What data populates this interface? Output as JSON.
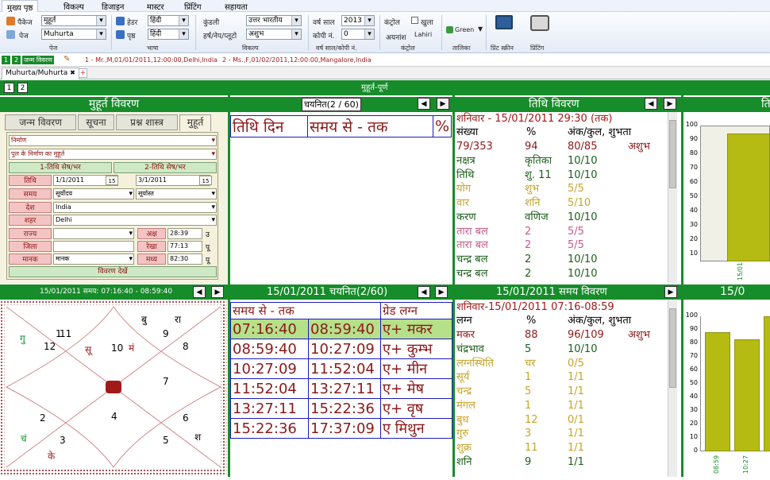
{
  "menu": [
    "मुख्य पृष्ठ",
    "विकल्प",
    "डिजाइन",
    "मास्टर",
    "प्रिंटिंग",
    "सहायता"
  ],
  "ribbon": {
    "package_label": "पैकेज",
    "package_value": "मुहूर्त",
    "page_label": "पेज",
    "page_value": "Muhurta",
    "group_page": "पेज",
    "header_label": "हेडर",
    "header_value": "हिंदी",
    "body_label": "पृष्ठ",
    "body_value": "हिंदी",
    "group_language": "भाषा",
    "kundali_label": "कुंडली",
    "kundali_value": "उत्तर भारतीय",
    "harsh_label": "हर्ष/नेप/प्लूटो",
    "harsh_value": "अशुभ",
    "group_option": "विकल्प",
    "year_label": "वर्ष साल",
    "year_value": "2013",
    "copy_label": "कोपी नं.",
    "copy_value": "0",
    "group_year": "वर्ष साल/कोपी नं.",
    "control_label": "कंट्रोल",
    "open_label": "खुला",
    "ayanamsha_label": "अयनांश",
    "ayanamsha_value": "Lahiri",
    "group_control": "कंट्रोल",
    "theme_value": "Green",
    "group_table": "तालिका",
    "print_screen": "प्रिंट स्क्रीन",
    "printing": "प्रिंटिंग"
  },
  "strip": {
    "n1": "1",
    "n2": "2",
    "janma": "जन्म विवरण",
    "rec1": "1 - Mr.,M,01/01/2011,12:00:00,Delhi,India",
    "rec2": "2 - Ms.,F,01/02/2011,12:00:00,Mangalore,India"
  },
  "doc_tab": {
    "label": "Muhurta/Muhurta",
    "close": "✖",
    "add": "+"
  },
  "top_bar": {
    "n1": "1",
    "n2": "2",
    "title": "मुहूर्त-पूर्ण"
  },
  "details": {
    "title": "मुहूर्त विवरण",
    "tabs": [
      "जन्म विवरण",
      "सूचना",
      "प्रश्न शास्त्र",
      "मुहूर्त"
    ],
    "sel1": "निर्माण",
    "sel2": "पुल के निर्माण का मुहूर्त",
    "tithi_btn1": "1-तिथि सेष/भर",
    "tithi_btn2": "2-तिथि सेष/भर",
    "tithi_label": "तिथि",
    "date1": "1/1/2011",
    "date2": "3/1/2011",
    "cal": "15",
    "samay_label": "समय",
    "samay1": "सूर्योदय",
    "samay2": "सूर्यास्त",
    "desh_label": "देश",
    "desh": "India",
    "shahar_label": "शहर",
    "shahar": "Delhi",
    "rajya_label": "राज्य",
    "aksh_label": "अक्ष",
    "aksh": "28:39",
    "aksh_dir": "उ",
    "jila_label": "जिला",
    "rekha_label": "रेखा",
    "rekha": "77:13",
    "rekha_dir": "पू",
    "manak_label": "मानक",
    "manak": "मानक",
    "madhya_label": "मध्य",
    "madhya": "82:30",
    "madhya_dir": "पू",
    "show_btn": "विवरण देखें"
  },
  "selected": {
    "title": "चयनित(2 / 60)",
    "h1": "तिथि दिन",
    "h2": "समय से - तक",
    "h3": "%"
  },
  "tithi": {
    "title": "तिथि विवरण",
    "line1": "शनिवार - 15/01/2011 29:30 (तक)",
    "header": [
      "संख्या",
      "%",
      "अंक/कुल, शुभता"
    ],
    "summary": [
      "79/353",
      "94",
      "80/85",
      "अशुभ"
    ],
    "rows": [
      [
        "नक्षत्र",
        "कृतिका",
        "10/10"
      ],
      [
        "तिथि",
        "शु. 11",
        "10/10"
      ],
      [
        "योग",
        "शुभ",
        "5/5"
      ],
      [
        "वार",
        "शनि",
        "5/10"
      ],
      [
        "करण",
        "वणिज",
        "10/10"
      ],
      [
        "तारा बल",
        "2",
        "5/5"
      ],
      [
        "तारा बल",
        "2",
        "5/5"
      ],
      [
        "चन्द्र बल",
        "2",
        "10/10"
      ],
      [
        "चन्द्र बल",
        "2",
        "10/10"
      ]
    ]
  },
  "chart_top": {
    "title": "ति",
    "ticks": [
      "100",
      "90",
      "80",
      "70",
      "60",
      "50",
      "40",
      "30",
      "20",
      "10"
    ],
    "xlabel": "15/01"
  },
  "lagna_bar": {
    "title": "15/01/2011 समय: 07:16:40 - 08:59:40"
  },
  "kundali": {
    "houses": [
      "1",
      "2",
      "3",
      "4",
      "5",
      "6",
      "7",
      "8",
      "9",
      "10",
      "11",
      "12"
    ],
    "planets": {
      "su": "सू",
      "ma": "मं",
      "bu": "बु",
      "ra": "रा",
      "gu": "गु",
      "ch": "चं",
      "ke": "के",
      "sh": "श"
    }
  },
  "lagna": {
    "title": "15/01/2011 चयनित(2/60)",
    "h1": "समय से - तक",
    "h2": "ग्रेड लग्न",
    "rows": [
      [
        "07:16:40",
        "08:59:40",
        "ए+ मकर"
      ],
      [
        "08:59:40",
        "10:27:09",
        "ए+ कुम्भ"
      ],
      [
        "10:27:09",
        "11:52:04",
        "ए+ मीन"
      ],
      [
        "11:52:04",
        "13:27:11",
        "ए+ मेष"
      ],
      [
        "13:27:11",
        "15:22:36",
        "ए+ वृष"
      ],
      [
        "15:22:36",
        "17:37:09",
        "ए  मिथुन"
      ]
    ]
  },
  "samay": {
    "title": "15/01/2011 समय विवरण",
    "line1": "शनिवार-15/01/2011 07:16-08:59",
    "header": [
      "लग्न",
      "%",
      "अंक/कुल, शुभता"
    ],
    "summary": [
      "मकर",
      "88",
      "96/109",
      "अशुभ"
    ],
    "rows": [
      [
        "चंद्रभाव",
        "5",
        "10/10"
      ],
      [
        "लग्नस्थिति",
        "चर",
        "0/5"
      ],
      [
        "सूर्य",
        "1",
        "1/1"
      ],
      [
        "चन्द्र",
        "5",
        "1/1"
      ],
      [
        "मंगल",
        "1",
        "1/1"
      ],
      [
        "बुध",
        "12",
        "0/1"
      ],
      [
        "गुरु",
        "3",
        "1/1"
      ],
      [
        "शुक्र",
        "11",
        "1/1"
      ],
      [
        "शनि",
        "9",
        "1/1"
      ]
    ]
  },
  "chart_bottom": {
    "title": "15/0",
    "ticks": [
      "100",
      "90",
      "80",
      "70",
      "60",
      "50",
      "40",
      "30",
      "20",
      "10",
      "0"
    ],
    "xlabels": [
      "08:59",
      "10:27",
      "11:"
    ]
  },
  "chart_data": [
    {
      "type": "bar",
      "categories": [
        "15/01"
      ],
      "values": [
        94
      ],
      "ylim": [
        0,
        100
      ]
    },
    {
      "type": "bar",
      "categories": [
        "08:59",
        "10:27",
        "11:"
      ],
      "values": [
        88,
        83,
        100
      ],
      "ylim": [
        0,
        100
      ]
    }
  ],
  "colors": {
    "green": "#178c2a",
    "olive": "#b5bb13",
    "maroon": "#8b1a1a",
    "blue": "#1b1bc0"
  }
}
